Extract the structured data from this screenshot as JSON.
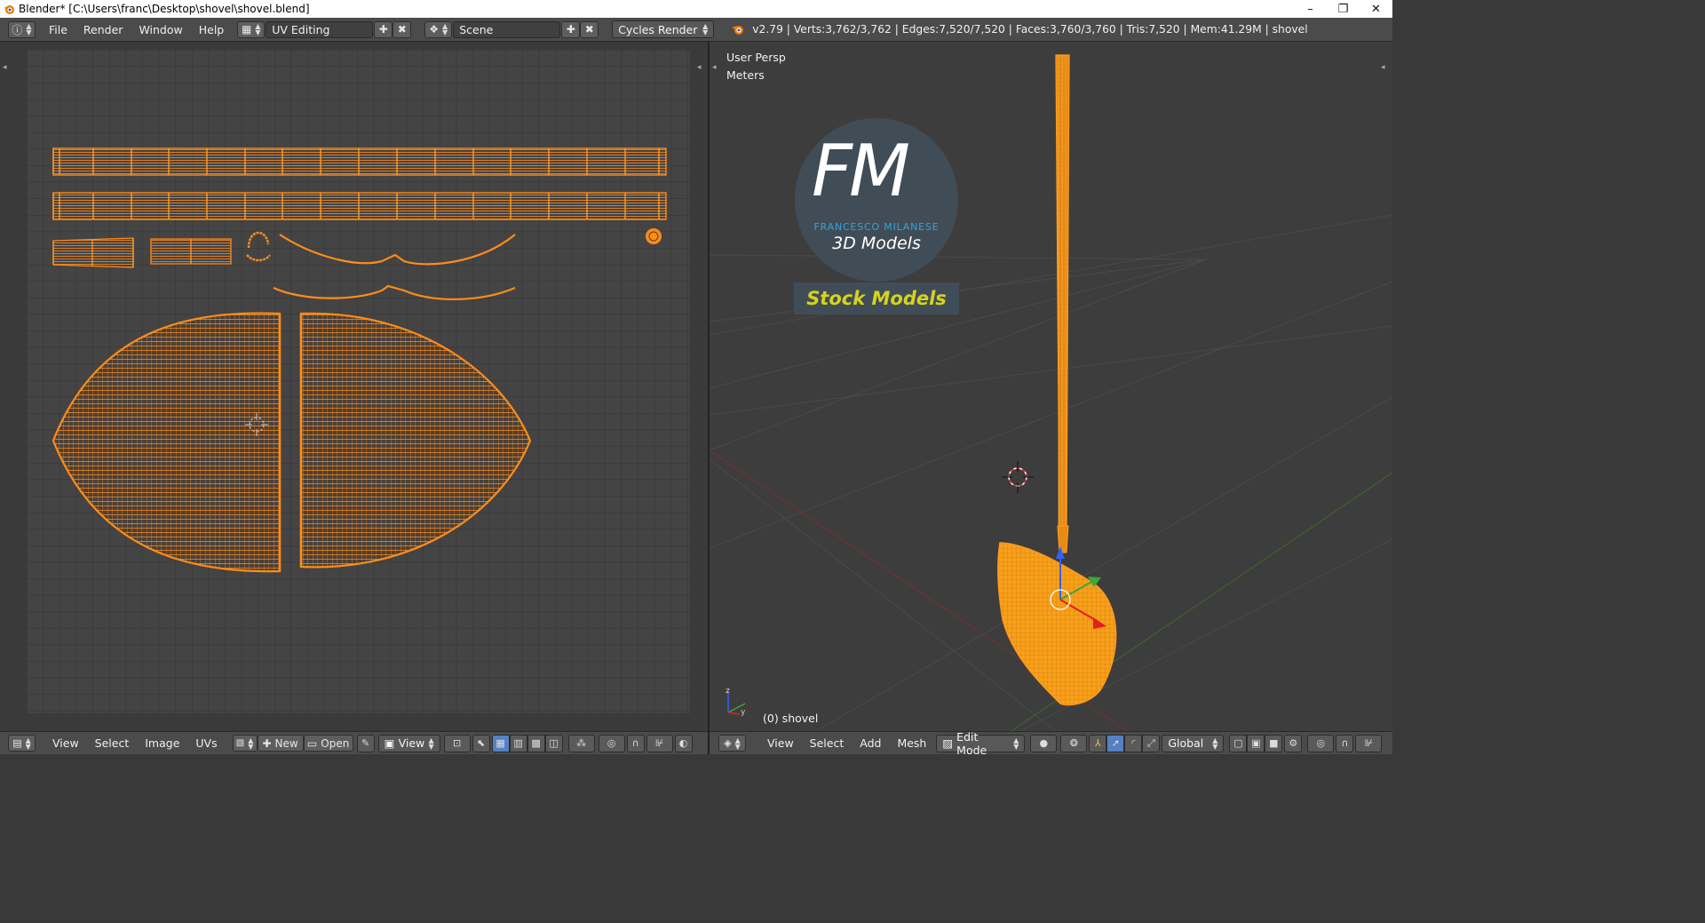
{
  "window": {
    "title": "Blender* [C:\\Users\\franc\\Desktop\\shovel\\shovel.blend]",
    "minimize": "–",
    "restore": "❐",
    "close": "✕"
  },
  "info_header": {
    "menus": [
      "File",
      "Render",
      "Window",
      "Help"
    ],
    "screen_layout": "UV Editing",
    "scene": "Scene",
    "render_engine": "Cycles Render",
    "stats": "v2.79 | Verts:3,762/3,762 | Edges:7,520/7,520 | Faces:3,760/3,760 | Tris:7,520 | Mem:41.29M | shovel"
  },
  "uv_editor": {
    "menus": [
      "View",
      "Select",
      "Image",
      "UVs"
    ],
    "new_label": "New",
    "open_label": "Open",
    "view_label": "View"
  },
  "viewport": {
    "view_name": "User Persp",
    "units": "Meters",
    "object_label": "(0) shovel",
    "menus": [
      "View",
      "Select",
      "Add",
      "Mesh"
    ],
    "mode": "Edit Mode",
    "orientation": "Global"
  },
  "watermark": {
    "logo_letters": "FM",
    "author": "FRANCESCO MILANESE",
    "subtitle": "3D Models",
    "tagline": "Stock Models"
  },
  "colors": {
    "uv_wire": "#ff8c1a",
    "accent_blue": "#2aa7e0",
    "tagline": "#d6d21e"
  }
}
